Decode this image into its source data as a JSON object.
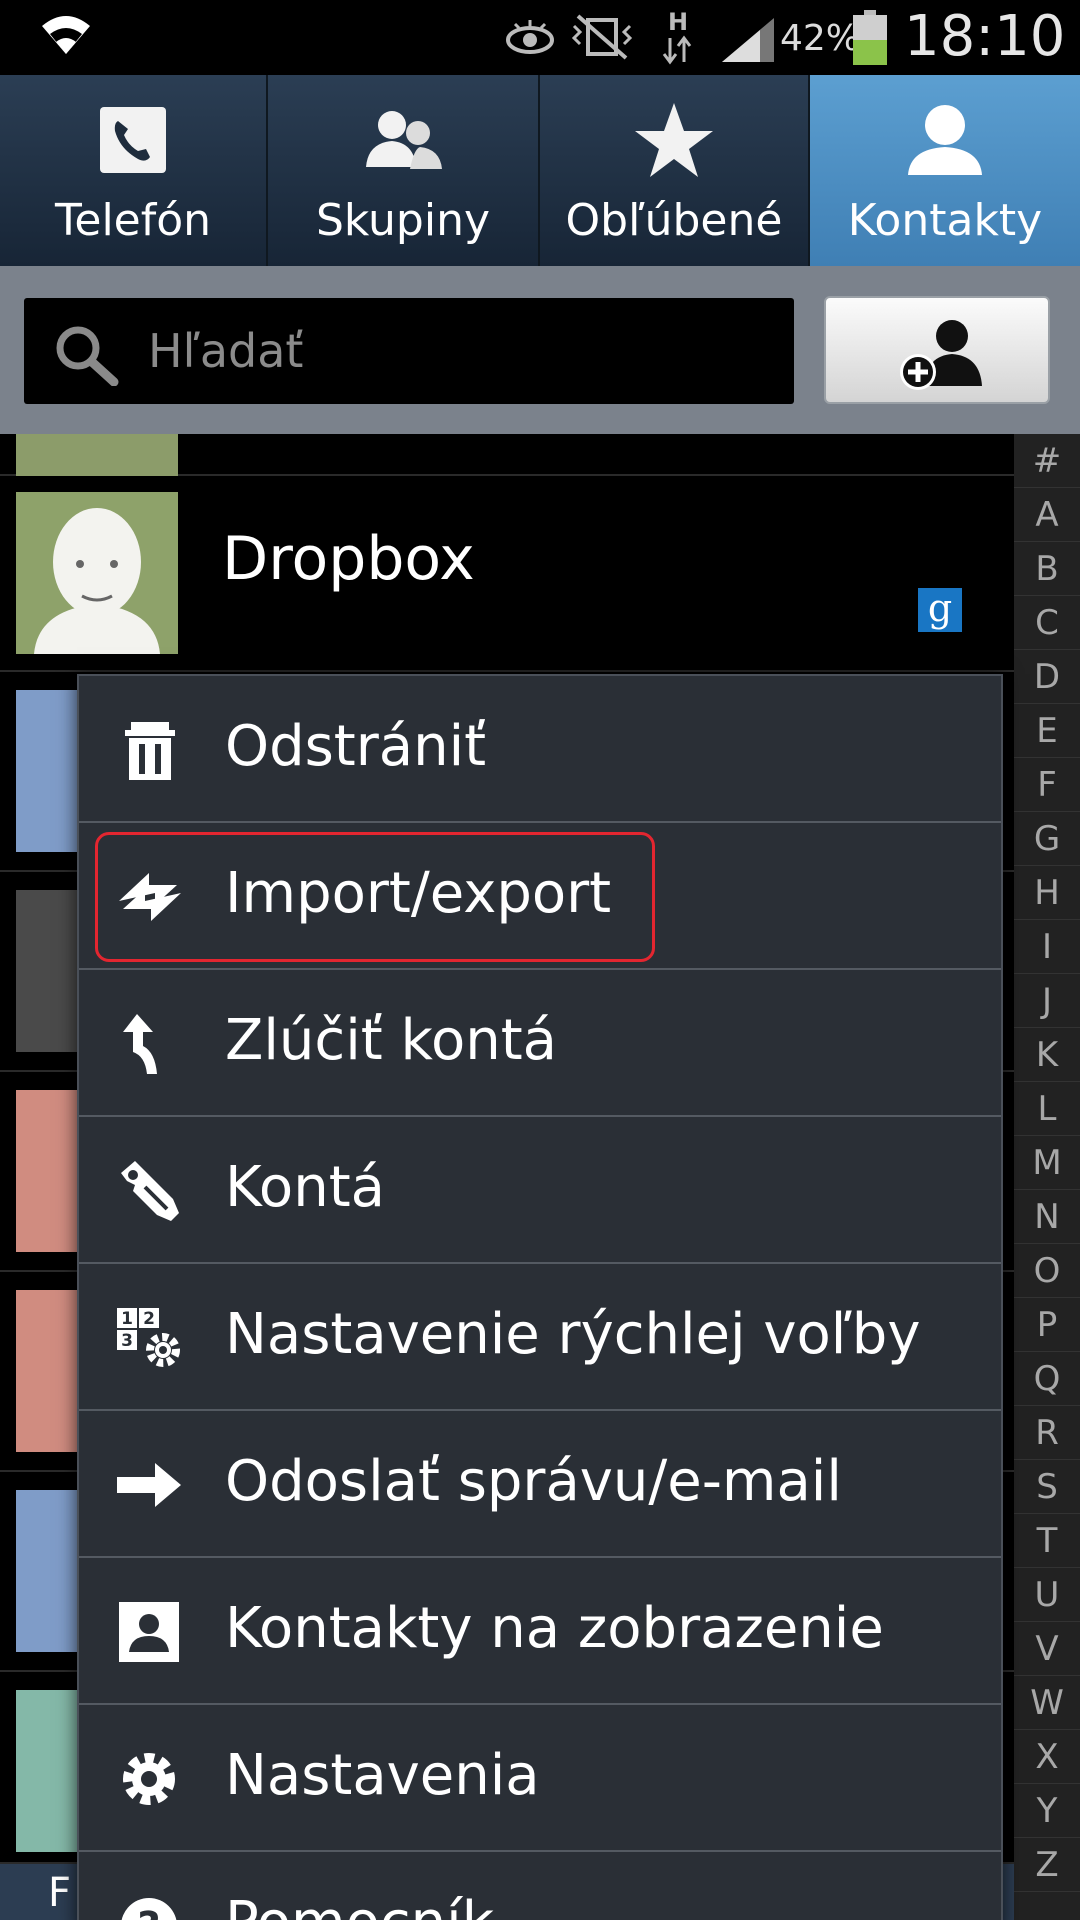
{
  "status_bar": {
    "battery_percent": "42%",
    "time": "18:10",
    "icons": [
      "wifi-icon",
      "smart-stay-eye-icon",
      "vibrate-icon",
      "hspa-icon",
      "signal-icon",
      "battery-icon"
    ],
    "battery_color": "#8bc34a"
  },
  "tabs": [
    {
      "label": "Telefón",
      "icon": "phone-icon",
      "active": false
    },
    {
      "label": "Skupiny",
      "icon": "groups-icon",
      "active": false
    },
    {
      "label": "Obľúbené",
      "icon": "star-icon",
      "active": false
    },
    {
      "label": "Kontakty",
      "icon": "person-icon",
      "active": true
    }
  ],
  "search": {
    "placeholder": "Hľadať",
    "value": ""
  },
  "contacts": [
    {
      "name": "Dropbox",
      "account": "google-badge-icon",
      "badge_text": "g"
    }
  ],
  "section_letter": "F",
  "alphabet_index": [
    "#",
    "A",
    "B",
    "C",
    "D",
    "E",
    "F",
    "G",
    "H",
    "I",
    "J",
    "K",
    "L",
    "M",
    "N",
    "O",
    "P",
    "Q",
    "R",
    "S",
    "T",
    "U",
    "V",
    "W",
    "X",
    "Y",
    "Z"
  ],
  "menu": {
    "items": [
      {
        "label": "Odstrániť",
        "icon": "trash-icon"
      },
      {
        "label": "Import/export",
        "icon": "import-export-icon",
        "highlighted": true
      },
      {
        "label": "Zlúčiť kontá",
        "icon": "merge-icon"
      },
      {
        "label": "Kontá",
        "icon": "accounts-key-icon"
      },
      {
        "label": "Nastavenie rýchlej voľby",
        "icon": "speed-dial-icon"
      },
      {
        "label": "Odoslať správu/e-mail",
        "icon": "arrow-right-icon"
      },
      {
        "label": "Kontakty na zobrazenie",
        "icon": "contact-card-icon"
      },
      {
        "label": "Nastavenia",
        "icon": "gear-icon"
      },
      {
        "label": "Pomocník",
        "icon": "help-icon"
      }
    ]
  },
  "colors": {
    "active_tab": "#4a8cc4",
    "highlight_border": "#e32630",
    "menu_background": "#2a2f36"
  }
}
